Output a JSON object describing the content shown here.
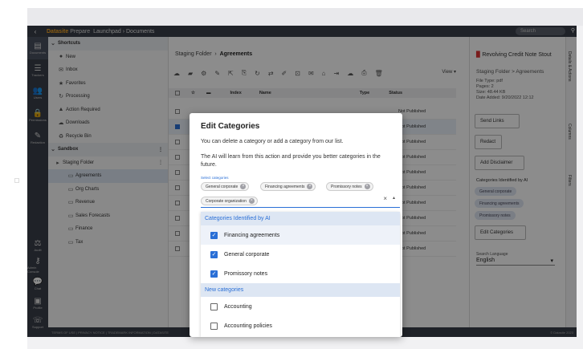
{
  "header": {
    "logo": "Datasite",
    "product": "Prepare",
    "breadcrumb": "Launchpad › Documents",
    "search_placeholder": "Search"
  },
  "rail": {
    "items": [
      "Documents",
      "Trackers",
      "Users",
      "Permissions",
      "Redaction"
    ],
    "bottom_items": [
      "Audit",
      "Admin Console",
      "Chat",
      "Profile",
      "Support"
    ]
  },
  "tree": {
    "shortcuts_label": "Shortcuts",
    "shortcuts": [
      "New",
      "Inbox",
      "Favorites",
      "Processing",
      "Action Required",
      "Downloads",
      "Recycle Bin"
    ],
    "sandbox_label": "Sandbox",
    "staging": "Staging Folder",
    "folders": [
      "Agreements",
      "Org Charts",
      "Revenue",
      "Sales Forecasts",
      "Finance",
      "Tax"
    ]
  },
  "main": {
    "crumb_parent": "Staging Folder",
    "crumb_current": "Agreements",
    "view_label": "View",
    "columns": {
      "index": "Index",
      "name": "Name",
      "type": "Type",
      "status": "Status"
    },
    "statuses": [
      "Not Published",
      "Not Published",
      "Not Published",
      "Not Published",
      "Not Published",
      "Not Published",
      "Not Published",
      "Not Published",
      "Not Published",
      "Not Published"
    ]
  },
  "details": {
    "title": "Revolving Credit Note Stout",
    "path": "Staging Folder > Agreements",
    "file_type": "File Type: pdf",
    "pages": "Pages: 2",
    "size": "Size: 48.44 KB",
    "date_added": "Date Added: 9/20/2022 12:12",
    "send_links": "Send Links",
    "redact": "Redact",
    "add_disclaimer": "Add Disclaimer",
    "ai_label": "Categories Identified by AI",
    "ai_chips": [
      "General corporate",
      "Financing agreements",
      "Promissory notes"
    ],
    "edit_categories": "Edit Categories",
    "search_language_label": "Search Language",
    "search_language": "English",
    "tabs": [
      "Details & Actions",
      "Columns",
      "Filters"
    ]
  },
  "footer": {
    "links": "TERMS OF USE | PRIVACY NOTICE | TRADEMARK INFORMATION | DATASITE",
    "copyright": "© Datasite 2023"
  },
  "modal": {
    "title": "Edit Categories",
    "line1": "You can delete a category or add a category from our list.",
    "line2": "The AI will learn from this action and provide you better categories in the future.",
    "selected_label": "Select categories",
    "chips": [
      "General corporate",
      "Financing agreements",
      "Promissory notes",
      "Corporate organization"
    ],
    "group_ai": "Categories Identified by AI",
    "ai_options": [
      "Financing agreements",
      "General corporate",
      "Promissory notes"
    ],
    "group_new": "New categories",
    "new_options": [
      "Accounting",
      "Accounting policies"
    ]
  }
}
